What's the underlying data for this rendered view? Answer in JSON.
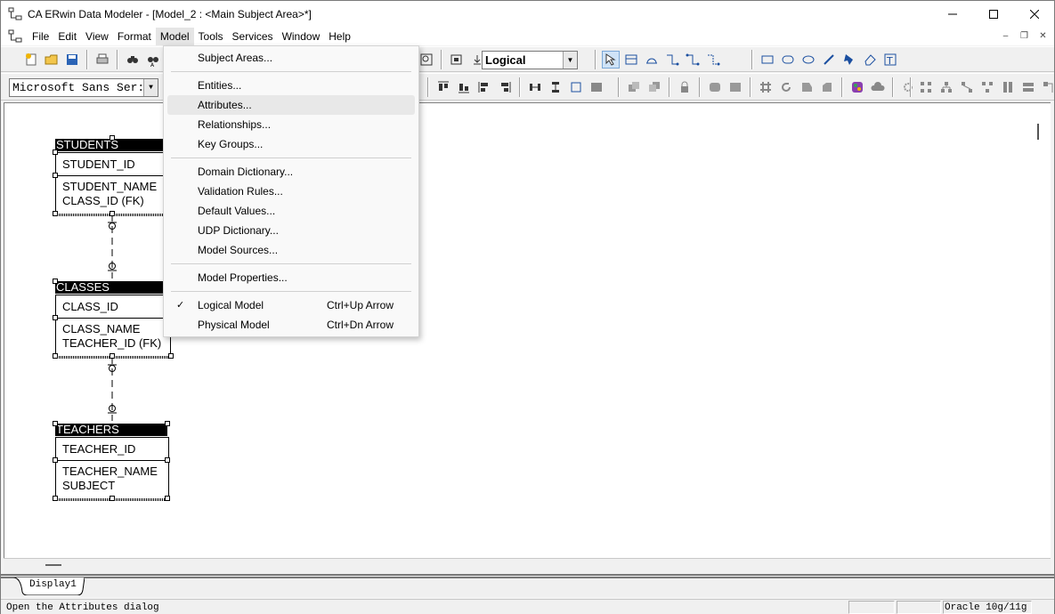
{
  "window": {
    "title": "CA ERwin Data Modeler - [Model_2 : <Main Subject Area>*]"
  },
  "menubar": {
    "items": [
      "File",
      "Edit",
      "View",
      "Format",
      "Model",
      "Tools",
      "Services",
      "Window",
      "Help"
    ],
    "active": "Model"
  },
  "toolbar": {
    "view_combo": "Logical",
    "font_combo": "Microsoft Sans Ser:"
  },
  "model_menu": {
    "items": [
      {
        "label": "Subject Areas..."
      },
      {
        "label": "Entities..."
      },
      {
        "label": "Attributes...",
        "highlighted": true
      },
      {
        "label": "Relationships..."
      },
      {
        "label": "Key Groups..."
      },
      {
        "label": "Domain Dictionary..."
      },
      {
        "label": "Validation Rules..."
      },
      {
        "label": "Default Values..."
      },
      {
        "label": "UDP Dictionary..."
      },
      {
        "label": "Model Sources..."
      },
      {
        "label": "Model Properties..."
      },
      {
        "label": "Logical Model",
        "shortcut": "Ctrl+Up Arrow",
        "checked": true
      },
      {
        "label": "Physical Model",
        "shortcut": "Ctrl+Dn Arrow"
      }
    ]
  },
  "diagram": {
    "entities": [
      {
        "name": "STUDENTS",
        "key": "STUDENT_ID",
        "attributes": [
          "STUDENT_NAME",
          "CLASS_ID (FK)"
        ]
      },
      {
        "name": "CLASSES",
        "key": "CLASS_ID",
        "attributes": [
          "CLASS_NAME",
          "TEACHER_ID (FK)"
        ]
      },
      {
        "name": "TEACHERS",
        "key": "TEACHER_ID",
        "attributes": [
          "TEACHER_NAME",
          "SUBJECT"
        ]
      }
    ]
  },
  "tabs": {
    "active": "Display1"
  },
  "statusbar": {
    "message": "Open the Attributes dialog",
    "database": "Oracle 10g/11g"
  }
}
